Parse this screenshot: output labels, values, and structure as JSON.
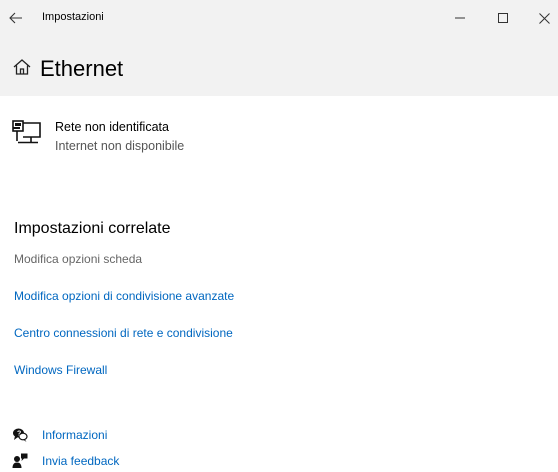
{
  "window": {
    "title": "Impostazioni",
    "controls": {
      "back": "back-arrow-icon",
      "minimize": "minimize-icon",
      "maximize": "maximize-icon",
      "close": "close-icon"
    }
  },
  "header": {
    "home_icon": "home-icon",
    "title": "Ethernet"
  },
  "network": {
    "icon": "network-computer-icon",
    "name": "Rete non identificata",
    "status": "Internet non disponibile"
  },
  "related": {
    "title": "Impostazioni correlate",
    "disabled_link": "Modifica opzioni scheda",
    "links": [
      "Modifica opzioni di condivisione avanzate",
      "Centro connessioni di rete e condivisione",
      "Windows Firewall"
    ]
  },
  "help": [
    {
      "icon": "chat-help-icon",
      "label": "Informazioni"
    },
    {
      "icon": "feedback-person-icon",
      "label": "Invia feedback"
    }
  ],
  "colors": {
    "header_bg": "#f2f2f2",
    "link": "#0067c0",
    "muted": "#666666"
  }
}
